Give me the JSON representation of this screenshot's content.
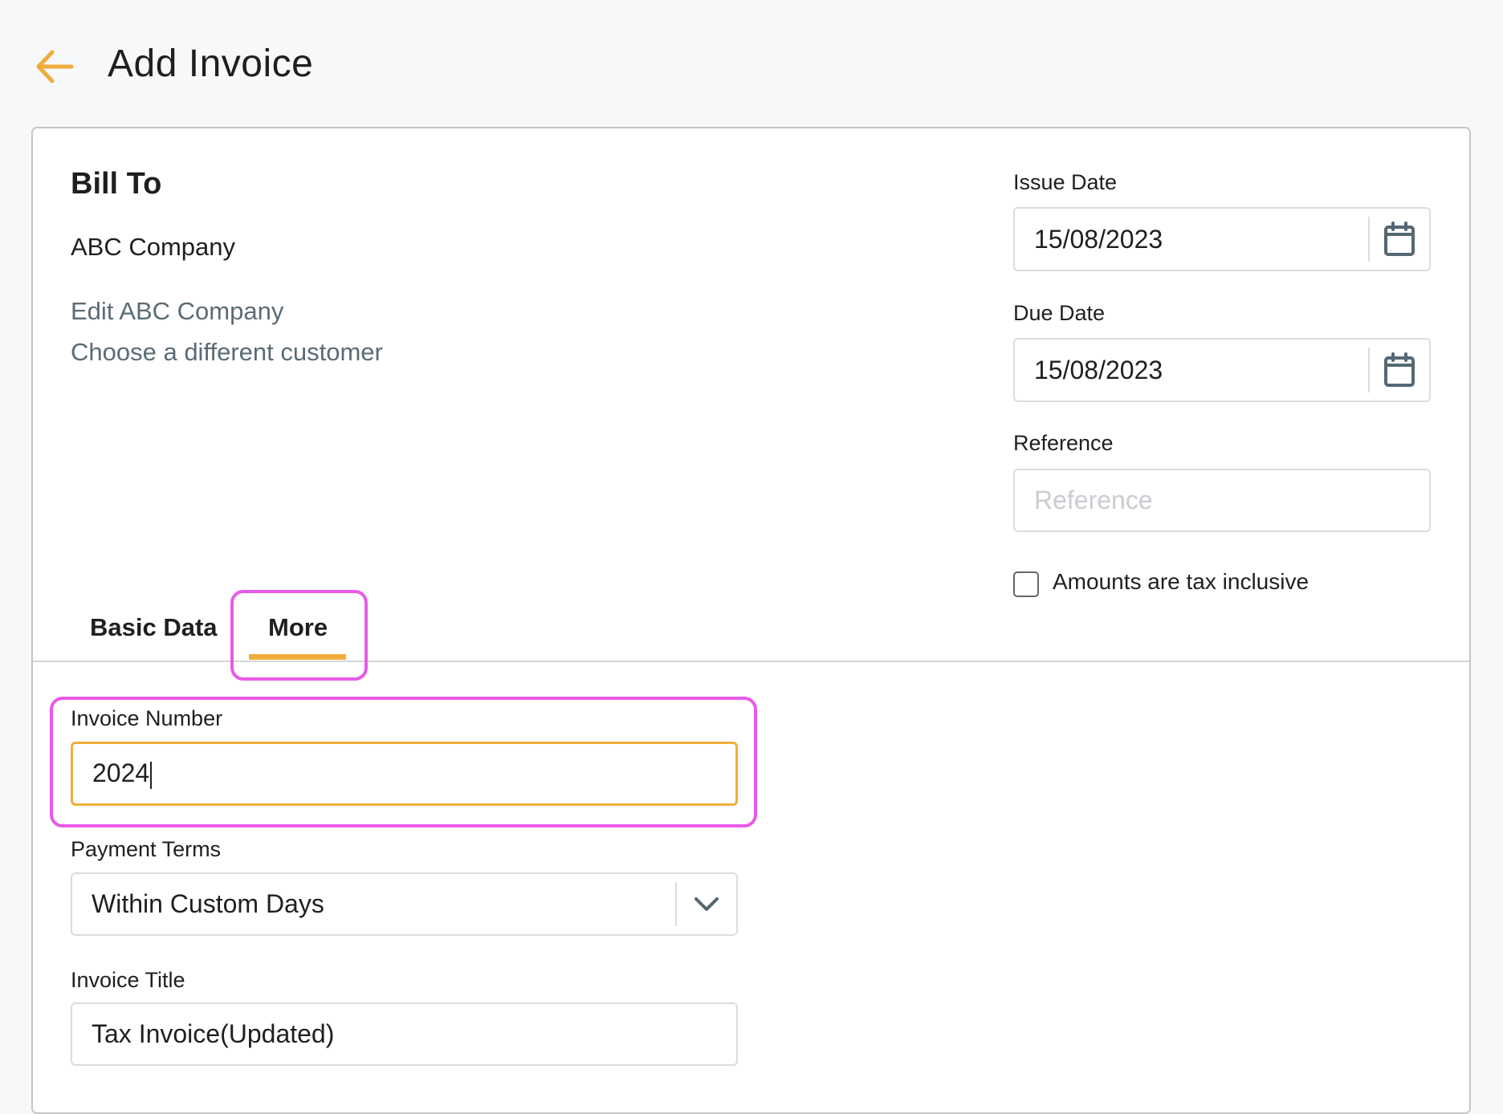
{
  "header": {
    "title": "Add Invoice",
    "back_icon": "arrow-left-icon"
  },
  "bill_to": {
    "heading": "Bill To",
    "customer_name": "ABC Company",
    "edit_link": "Edit ABC Company",
    "change_link": "Choose a different customer"
  },
  "dates": {
    "issue_date_label": "Issue Date",
    "issue_date_value": "15/08/2023",
    "due_date_label": "Due Date",
    "due_date_value": "15/08/2023",
    "calendar_icon": "calendar-icon"
  },
  "reference": {
    "label": "Reference",
    "value": "",
    "placeholder": "Reference"
  },
  "tax_inclusive": {
    "label": "Amounts are tax inclusive",
    "checked": false
  },
  "tabs": [
    {
      "label": "Basic Data",
      "active": false
    },
    {
      "label": "More",
      "active": true
    }
  ],
  "more_tab": {
    "invoice_number_label": "Invoice Number",
    "invoice_number_value": "2024",
    "payment_terms_label": "Payment Terms",
    "payment_terms_value": "Within Custom Days",
    "invoice_title_label": "Invoice Title",
    "invoice_title_value": "Tax Invoice(Updated)"
  },
  "colors": {
    "accent": "#f0ad3d",
    "link": "#5a6b76",
    "highlight": "#e95ae8",
    "icon": "#546873"
  }
}
